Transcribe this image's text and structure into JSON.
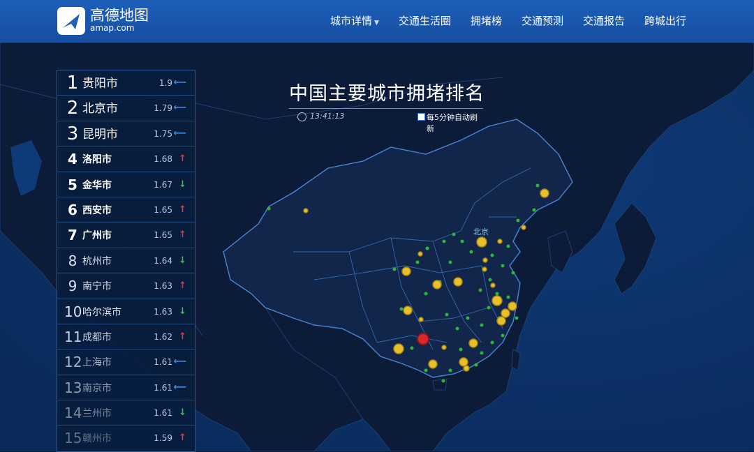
{
  "header": {
    "brand_cn": "高德地图",
    "brand_en": "amap.com",
    "nav": [
      "城市详情",
      "交通生活圈",
      "拥堵榜",
      "交通预测",
      "交通报告",
      "跨城出行"
    ]
  },
  "title": {
    "text": "中国主要城市拥堵排名",
    "time": "13:41:13",
    "refresh": "每5分钟自动刷新"
  },
  "map_label": "北京",
  "ranking": [
    {
      "rank": "1",
      "city": "贵阳市",
      "value": "1.9",
      "trend": "flat"
    },
    {
      "rank": "2",
      "city": "北京市",
      "value": "1.79",
      "trend": "flat"
    },
    {
      "rank": "3",
      "city": "昆明市",
      "value": "1.75",
      "trend": "flat"
    },
    {
      "rank": "4",
      "city": "洛阳市",
      "value": "1.68",
      "trend": "up"
    },
    {
      "rank": "5",
      "city": "金华市",
      "value": "1.67",
      "trend": "down"
    },
    {
      "rank": "6",
      "city": "西安市",
      "value": "1.65",
      "trend": "up"
    },
    {
      "rank": "7",
      "city": "广州市",
      "value": "1.65",
      "trend": "up"
    },
    {
      "rank": "8",
      "city": "杭州市",
      "value": "1.64",
      "trend": "down"
    },
    {
      "rank": "9",
      "city": "南宁市",
      "value": "1.63",
      "trend": "up"
    },
    {
      "rank": "10",
      "city": "哈尔滨市",
      "value": "1.63",
      "trend": "down"
    },
    {
      "rank": "11",
      "city": "成都市",
      "value": "1.62",
      "trend": "up"
    },
    {
      "rank": "12",
      "city": "上海市",
      "value": "1.61",
      "trend": "flat"
    },
    {
      "rank": "13",
      "city": "南京市",
      "value": "1.61",
      "trend": "flat"
    },
    {
      "rank": "14",
      "city": "兰州市",
      "value": "1.61",
      "trend": "down"
    },
    {
      "rank": "15",
      "city": "赣州市",
      "value": "1.59",
      "trend": "up"
    }
  ],
  "colors": {
    "up": "#e03a3a",
    "down": "#3fbf4a",
    "flat": "#3f8de6",
    "header": "#1d5fb9",
    "hotspot": "#d62a2a",
    "yellow": "#e8c02a",
    "green": "#2fb53a"
  }
}
